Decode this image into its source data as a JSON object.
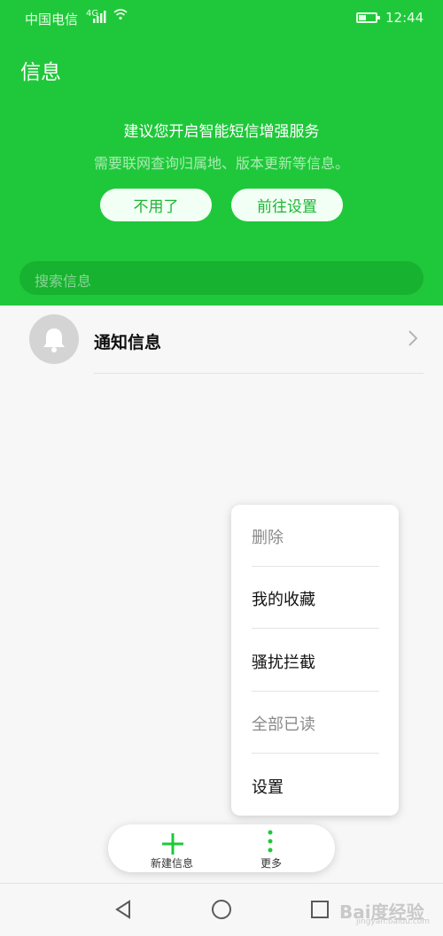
{
  "status_bar": {
    "carrier": "中国电信",
    "network": "4G",
    "time": "12:44",
    "battery_level": 0.45
  },
  "header": {
    "title": "信息",
    "promo_title": "建议您开启智能短信增强服务",
    "promo_subtitle": "需要联网查询归属地、版本更新等信息。",
    "decline_label": "不用了",
    "settings_label": "前往设置"
  },
  "search": {
    "placeholder": "搜索信息"
  },
  "conversations": [
    {
      "title": "通知信息",
      "icon": "bell-icon"
    }
  ],
  "overflow_menu": {
    "items": [
      {
        "label": "删除",
        "enabled": false
      },
      {
        "label": "我的收藏",
        "enabled": true
      },
      {
        "label": "骚扰拦截",
        "enabled": true
      },
      {
        "label": "全部已读",
        "enabled": false
      },
      {
        "label": "设置",
        "enabled": true
      }
    ]
  },
  "bottom_actions": {
    "new_label": "新建信息",
    "more_label": "更多"
  },
  "watermark": {
    "text": "Bai度经验",
    "url": "jingyan.baidu.com"
  },
  "colors": {
    "brand_green": "#1fc83a",
    "disabled_text": "#8a8a8a",
    "enabled_text": "#111111"
  }
}
